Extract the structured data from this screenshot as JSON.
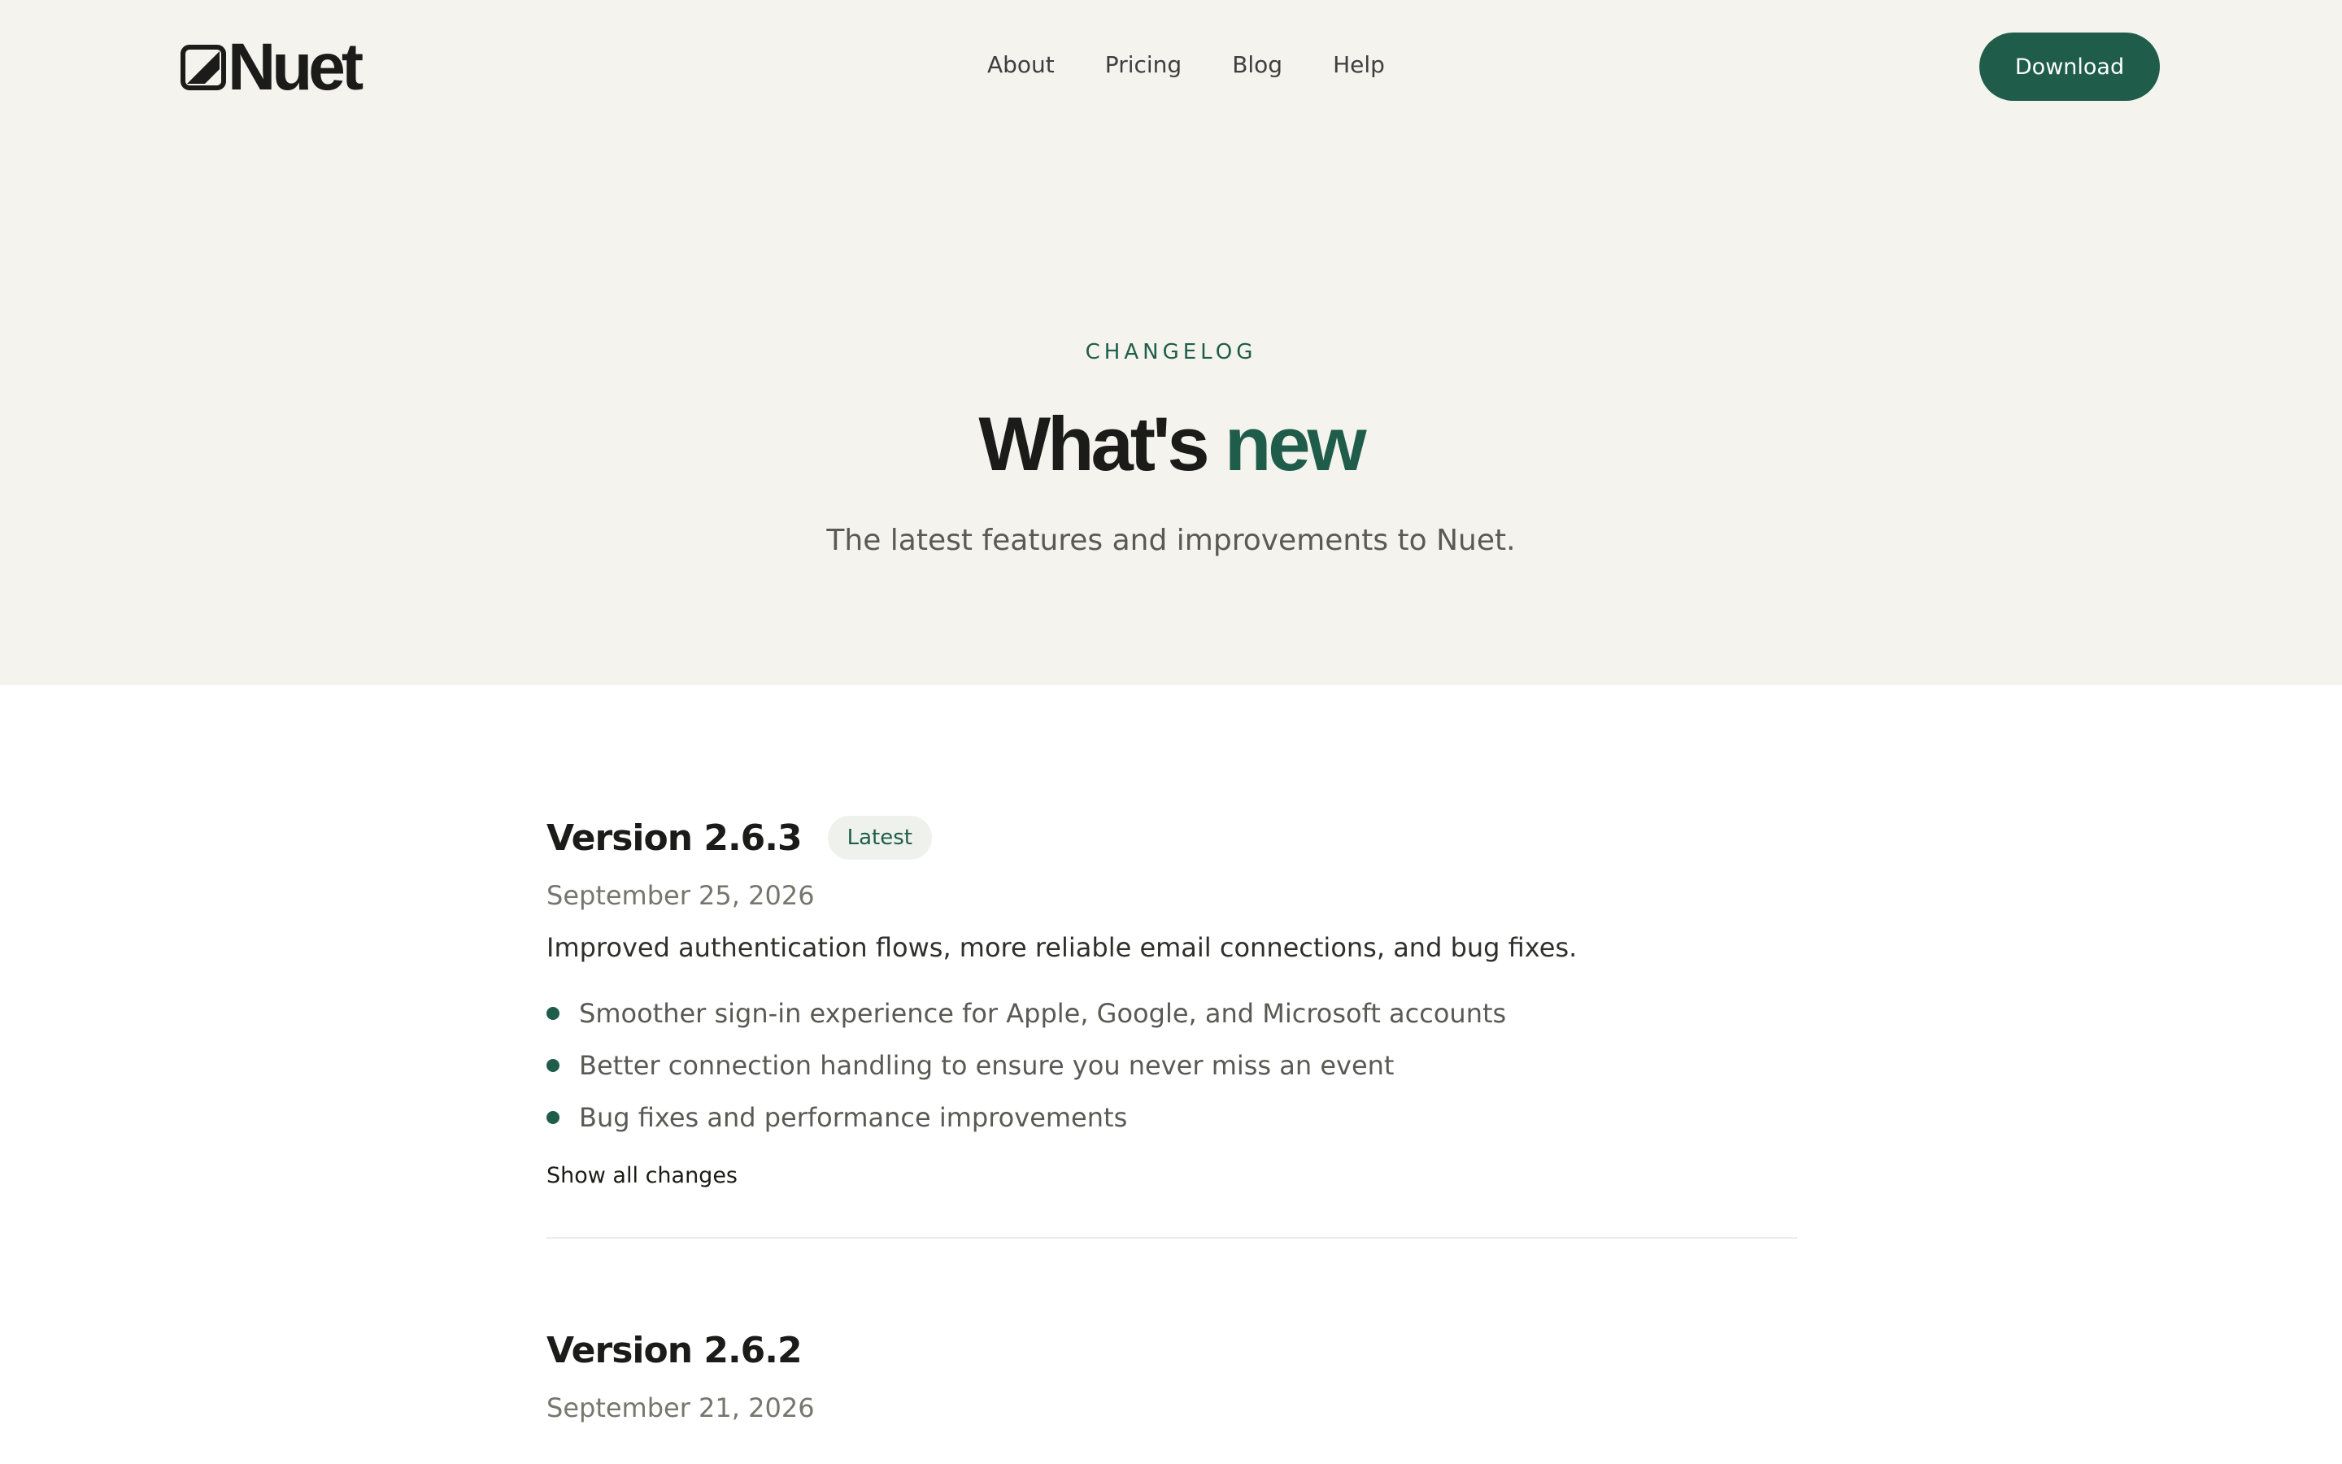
{
  "brand": {
    "name": "Nuet"
  },
  "nav": {
    "items": [
      {
        "label": "About"
      },
      {
        "label": "Pricing"
      },
      {
        "label": "Blog"
      },
      {
        "label": "Help"
      }
    ],
    "cta_label": "Download"
  },
  "hero": {
    "eyebrow": "CHANGELOG",
    "title_main": "What's",
    "title_accent": "new",
    "subtitle": "The latest features and improvements to Nuet."
  },
  "releases": [
    {
      "version": "Version 2.6.3",
      "badge": "Latest",
      "date": "September 25, 2026",
      "summary": "Improved authentication flows, more reliable email connections, and bug fixes.",
      "changes": [
        "Smoother sign-in experience for Apple, Google, and Microsoft accounts",
        "Better connection handling to ensure you never miss an event",
        "Bug fixes and performance improvements"
      ],
      "show_all_label": "Show all changes"
    },
    {
      "version": "Version 2.6.2",
      "date": "September 21, 2026"
    }
  ],
  "colors": {
    "accent": "#1f5d4a",
    "hero_bg": "#f4f3ee",
    "text": "#1b1b19",
    "muted": "#76766f"
  }
}
